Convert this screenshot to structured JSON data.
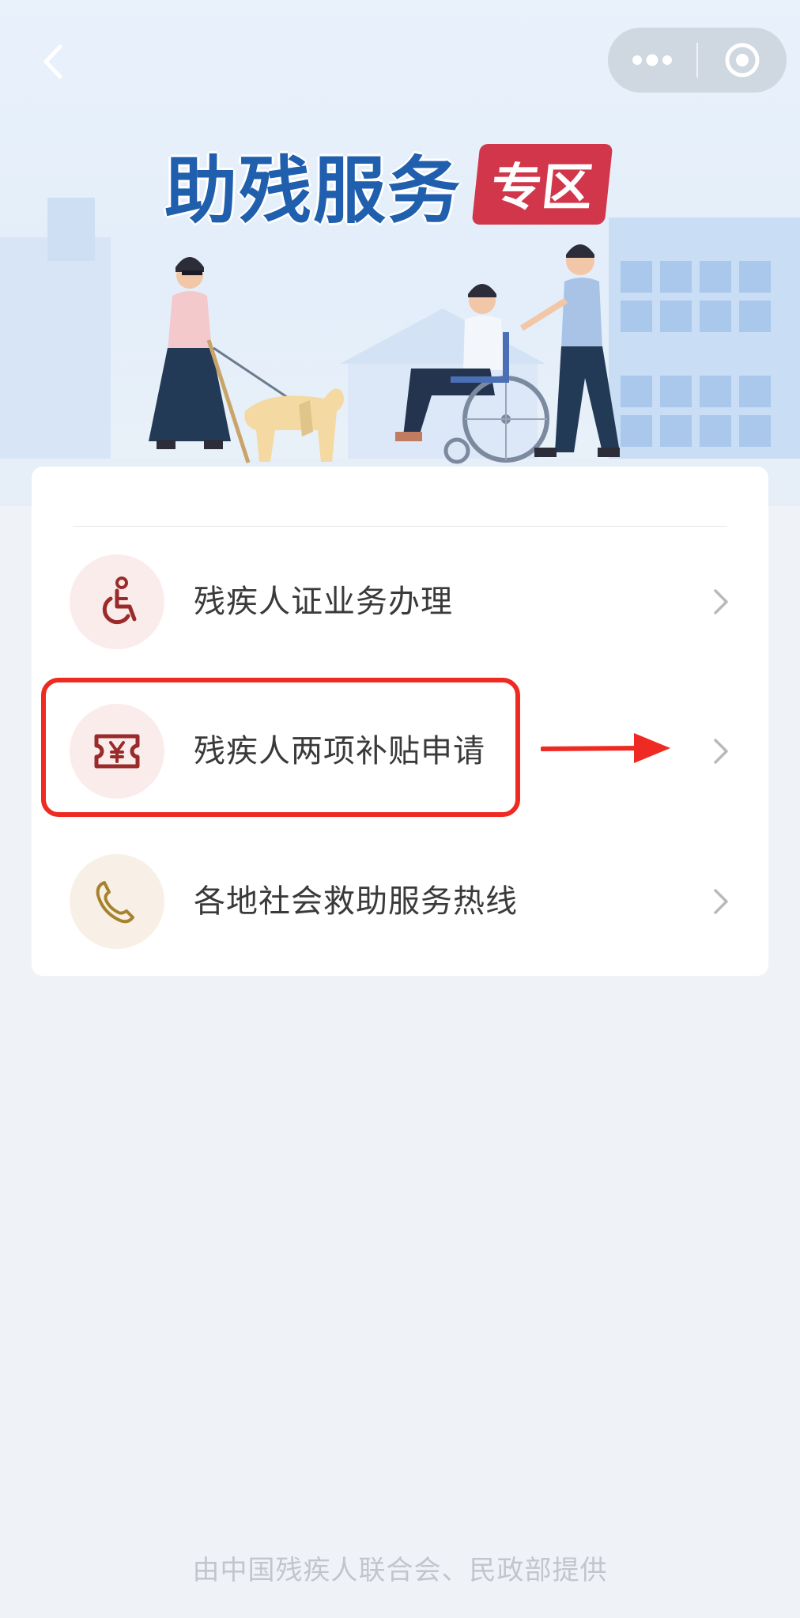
{
  "nav": {
    "back_icon": "chevron-left-icon",
    "capsule": {
      "menu_icon": "more-dots-icon",
      "close_icon": "target-circle-icon"
    }
  },
  "hero": {
    "title_main": "助残服务",
    "title_tag": "专区",
    "colors": {
      "title": "#1f5fae",
      "tag": "#d1364a"
    }
  },
  "menu": {
    "items": [
      {
        "label": "残疾人证业务办理",
        "icon": "wheelchair-icon",
        "icon_bg": "#fbecec",
        "icon_color": "#9b2b2b"
      },
      {
        "label": "残疾人两项补贴申请",
        "icon": "yuan-ticket-icon",
        "icon_bg": "#fbecec",
        "icon_color": "#9b2b2b"
      },
      {
        "label": "各地社会救助服务热线",
        "icon": "phone-icon",
        "icon_bg": "#f8f0e6",
        "icon_color": "#a7822e"
      }
    ]
  },
  "annotation": {
    "highlight_color": "#ee2a22"
  },
  "footer": {
    "text": "由中国残疾人联合会、民政部提供"
  }
}
